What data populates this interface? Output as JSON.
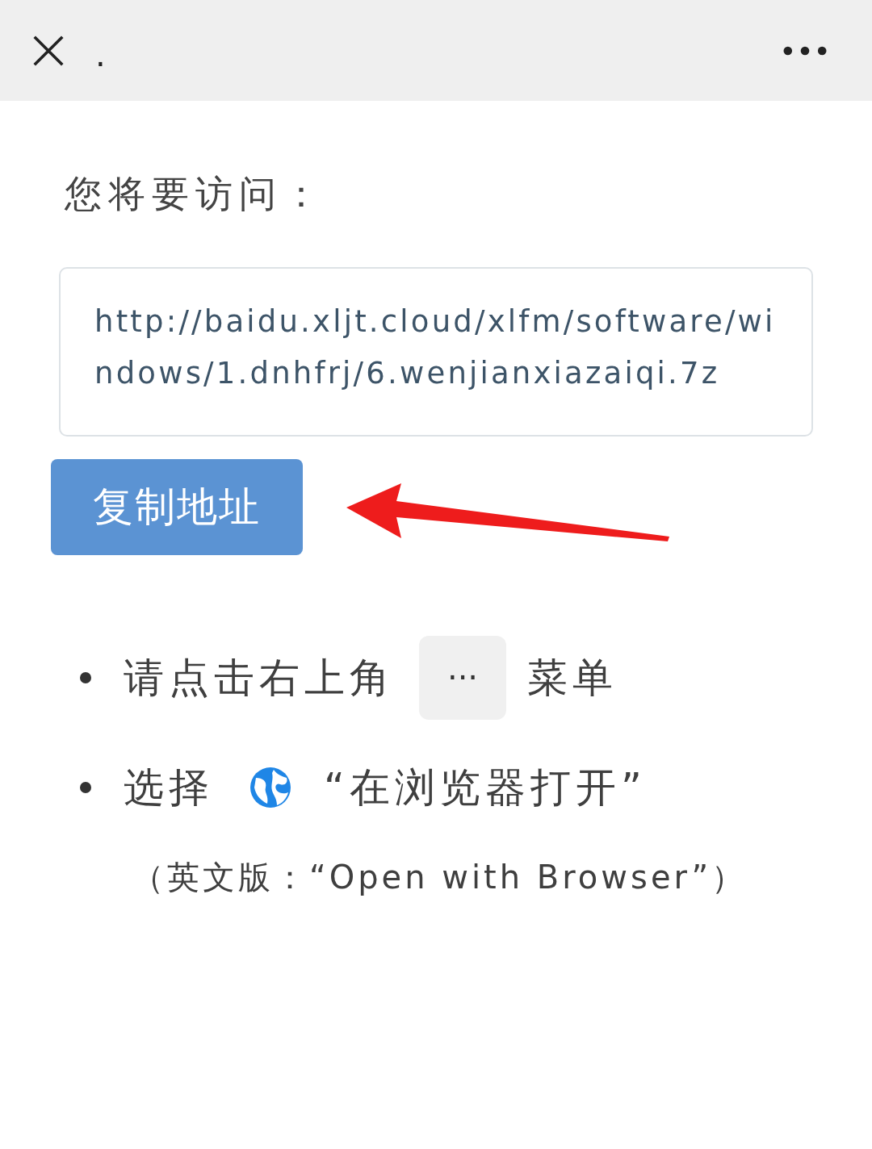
{
  "top_bar": {
    "title": "."
  },
  "heading": "您将要访问：",
  "url": "http://baidu.xljt.cloud/xlfm/software/windows/1.dnhfrj/6.wenjianxiazaiqi.7z",
  "copy_button": "复制地址",
  "steps": [
    {
      "kind": "menu",
      "before": "请点击右上角",
      "chip": "···",
      "after": "菜单"
    },
    {
      "kind": "browser",
      "before": "选择",
      "after": "“在浏览器打开”"
    }
  ],
  "note": "（英文版：“Open with Browser”）"
}
